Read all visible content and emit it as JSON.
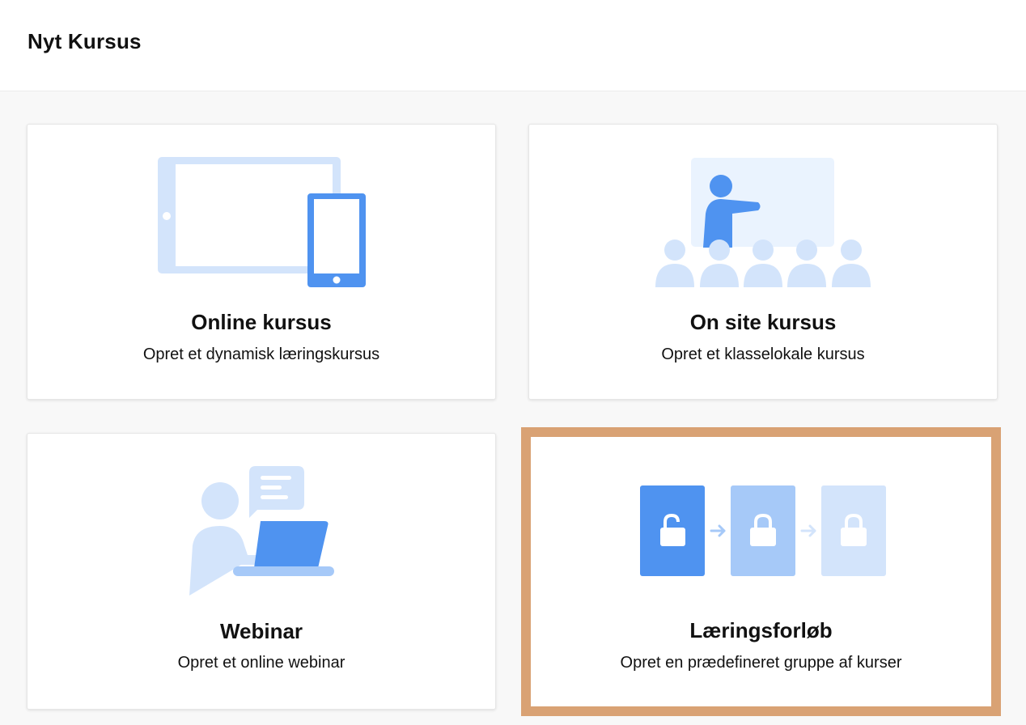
{
  "header": {
    "title": "Nyt Kursus"
  },
  "colors": {
    "primary_blue": "#4f93f0",
    "mid_blue": "#a6c9f8",
    "light_blue": "#d3e4fb",
    "pale_blue": "#eaf3fe",
    "highlight_border": "#d9a274"
  },
  "cards": [
    {
      "id": "online",
      "title": "Online kursus",
      "subtitle": "Opret et dynamisk læringskursus",
      "icon": "devices-icon"
    },
    {
      "id": "onsite",
      "title": "On site kursus",
      "subtitle": "Opret et klasselokale kursus",
      "icon": "classroom-icon"
    },
    {
      "id": "webinar",
      "title": "Webinar",
      "subtitle": "Opret et online webinar",
      "icon": "webinar-icon"
    },
    {
      "id": "path",
      "title": "Læringsforløb",
      "subtitle": "Opret en prædefineret gruppe af kurser",
      "icon": "learning-path-icon",
      "highlighted": true
    }
  ]
}
